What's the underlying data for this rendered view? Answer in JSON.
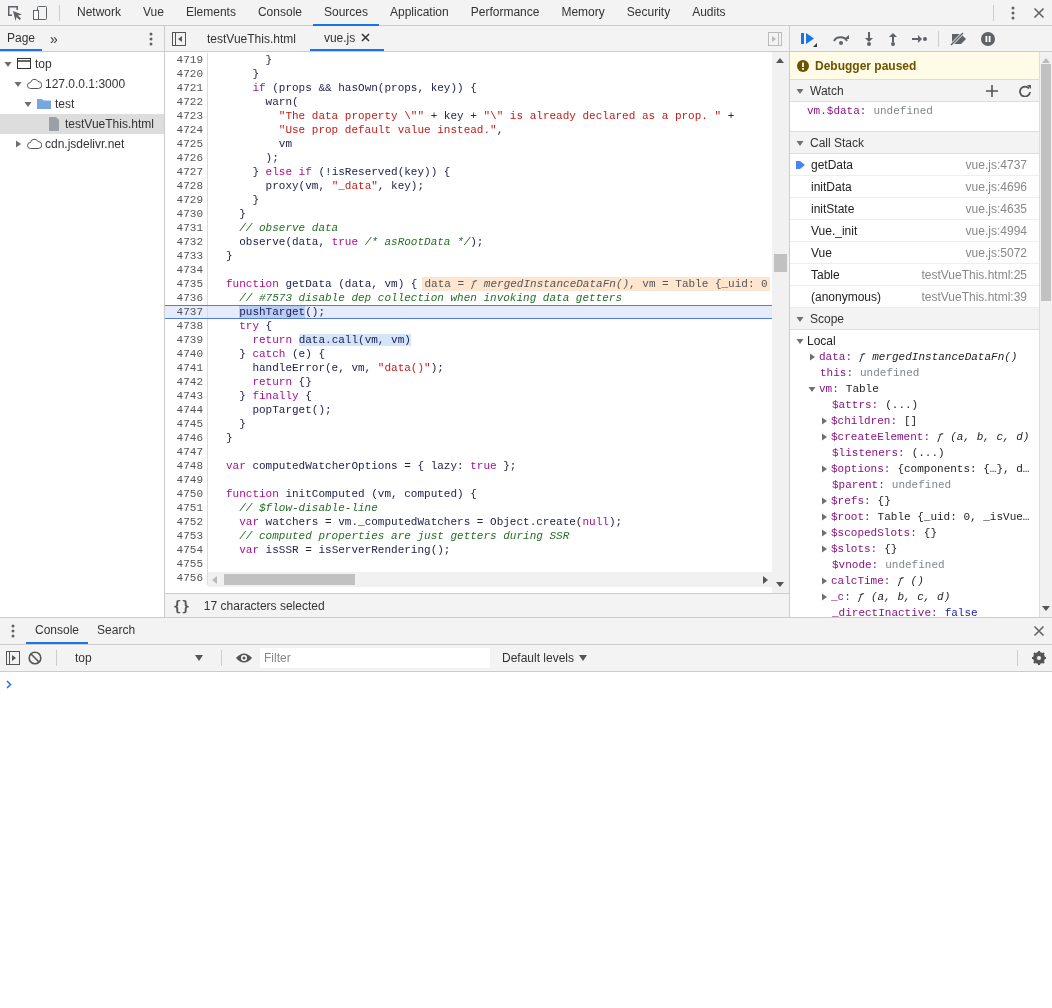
{
  "main_tabs": [
    {
      "label": "Network",
      "selected": false
    },
    {
      "label": "Vue",
      "selected": false
    },
    {
      "label": "Elements",
      "selected": false
    },
    {
      "label": "Console",
      "selected": false
    },
    {
      "label": "Sources",
      "selected": true
    },
    {
      "label": "Application",
      "selected": false
    },
    {
      "label": "Performance",
      "selected": false
    },
    {
      "label": "Memory",
      "selected": false
    },
    {
      "label": "Security",
      "selected": false
    },
    {
      "label": "Audits",
      "selected": false
    }
  ],
  "navigator": {
    "tabs": [
      {
        "label": "Page",
        "selected": true
      }
    ],
    "more_tabs": "»",
    "tree": [
      {
        "label": "top",
        "kind": "frame",
        "expanded": true,
        "selected": false,
        "children": [
          {
            "label": "127.0.0.1:3000",
            "kind": "domain",
            "expanded": true,
            "selected": false,
            "children": [
              {
                "label": "test",
                "kind": "folder",
                "expanded": true,
                "selected": false,
                "children": [
                  {
                    "label": "testVueThis.html",
                    "kind": "file",
                    "selected": true
                  }
                ]
              }
            ]
          },
          {
            "label": "cdn.jsdelivr.net",
            "kind": "domain",
            "expanded": false,
            "selected": false
          }
        ]
      }
    ]
  },
  "editor": {
    "tabs": [
      {
        "label": "testVueThis.html",
        "selected": false,
        "closable": false
      },
      {
        "label": "vue.js",
        "selected": true,
        "closable": true
      }
    ],
    "lines": [
      {
        "n": "4719",
        "current": false,
        "tokens": [
          {
            "t": "      }",
            "kind": "txt"
          }
        ]
      },
      {
        "n": "4720",
        "current": false,
        "tokens": [
          {
            "t": "    }",
            "kind": "txt"
          }
        ]
      },
      {
        "n": "4721",
        "current": false,
        "tokens": [
          {
            "t": "    if",
            "kind": "kw"
          },
          {
            "t": " (props && hasOwn(props, key)) {",
            "kind": "txt"
          }
        ]
      },
      {
        "n": "4722",
        "current": false,
        "tokens": [
          {
            "t": "      warn(",
            "kind": "txt"
          }
        ]
      },
      {
        "n": "4723",
        "current": false,
        "tokens": [
          {
            "t": "        \"The data property \\\"\"",
            "kind": "str"
          },
          {
            "t": " + key + ",
            "kind": "txt"
          },
          {
            "t": "\"\\\" is already declared as a prop. \"",
            "kind": "str"
          },
          {
            "t": " +",
            "kind": "txt"
          }
        ]
      },
      {
        "n": "4724",
        "current": false,
        "tokens": [
          {
            "t": "        \"Use prop default value instead.\"",
            "kind": "str"
          },
          {
            "t": ",",
            "kind": "txt"
          }
        ]
      },
      {
        "n": "4725",
        "current": false,
        "tokens": [
          {
            "t": "        vm",
            "kind": "txt"
          }
        ]
      },
      {
        "n": "4726",
        "current": false,
        "tokens": [
          {
            "t": "      );",
            "kind": "txt"
          }
        ]
      },
      {
        "n": "4727",
        "current": false,
        "tokens": [
          {
            "t": "    } ",
            "kind": "txt"
          },
          {
            "t": "else if",
            "kind": "kw"
          },
          {
            "t": " (!isReserved(key)) {",
            "kind": "txt"
          }
        ]
      },
      {
        "n": "4728",
        "current": false,
        "tokens": [
          {
            "t": "      proxy(vm, ",
            "kind": "txt"
          },
          {
            "t": "\"_data\"",
            "kind": "str"
          },
          {
            "t": ", key);",
            "kind": "txt"
          }
        ]
      },
      {
        "n": "4729",
        "current": false,
        "tokens": [
          {
            "t": "    }",
            "kind": "txt"
          }
        ]
      },
      {
        "n": "4730",
        "current": false,
        "tokens": [
          {
            "t": "  }",
            "kind": "txt"
          }
        ]
      },
      {
        "n": "4731",
        "current": false,
        "tokens": [
          {
            "t": "  // observe data",
            "kind": "cmt"
          }
        ]
      },
      {
        "n": "4732",
        "current": false,
        "tokens": [
          {
            "t": "  observe(data, ",
            "kind": "txt"
          },
          {
            "t": "true",
            "kind": "atom"
          },
          {
            "t": " /* asRootData */",
            "kind": "cmt"
          },
          {
            "t": ");",
            "kind": "txt"
          }
        ]
      },
      {
        "n": "4733",
        "current": false,
        "tokens": [
          {
            "t": "}",
            "kind": "txt"
          }
        ]
      },
      {
        "n": "4734",
        "current": false
      },
      {
        "n": "4735",
        "current": false,
        "tokens": [
          {
            "t": "function",
            "kind": "kw"
          },
          {
            "t": " getData (data, vm) {",
            "kind": "txt"
          }
        ],
        "inline_value": "data = *ƒ mergedInstanceDataFn()*, vm = Table {_uid: 0"
      },
      {
        "n": "4736",
        "current": false,
        "tokens": [
          {
            "t": "  // #7573 disable dep collection when invoking data getters",
            "kind": "cmt"
          }
        ]
      },
      {
        "n": "4737",
        "current": true,
        "tokens": [
          {
            "t": "  pushTarget",
            "kind": "txt",
            "selected": true
          },
          {
            "t": "();",
            "kind": "txt"
          }
        ]
      },
      {
        "n": "4738",
        "current": false,
        "tokens": [
          {
            "t": "  try",
            "kind": "kw"
          },
          {
            "t": " {",
            "kind": "txt"
          }
        ]
      },
      {
        "n": "4739",
        "current": false,
        "tokens": [
          {
            "t": "    return",
            "kind": "kw"
          },
          {
            "t": " data.call(vm, vm)",
            "kind": "txt",
            "evaluated": true
          }
        ]
      },
      {
        "n": "4740",
        "current": false,
        "tokens": [
          {
            "t": "  } ",
            "kind": "txt"
          },
          {
            "t": "catch",
            "kind": "kw"
          },
          {
            "t": " (e) {",
            "kind": "txt"
          }
        ]
      },
      {
        "n": "4741",
        "current": false,
        "tokens": [
          {
            "t": "    handleError(e, vm, ",
            "kind": "txt"
          },
          {
            "t": "\"data()\"",
            "kind": "str"
          },
          {
            "t": ");",
            "kind": "txt"
          }
        ]
      },
      {
        "n": "4742",
        "current": false,
        "tokens": [
          {
            "t": "    return",
            "kind": "kw"
          },
          {
            "t": " {}",
            "kind": "txt"
          }
        ]
      },
      {
        "n": "4743",
        "current": false,
        "tokens": [
          {
            "t": "  } ",
            "kind": "txt"
          },
          {
            "t": "finally",
            "kind": "kw"
          },
          {
            "t": " {",
            "kind": "txt"
          }
        ]
      },
      {
        "n": "4744",
        "current": false,
        "tokens": [
          {
            "t": "    popTarget();",
            "kind": "txt"
          }
        ]
      },
      {
        "n": "4745",
        "current": false,
        "tokens": [
          {
            "t": "  }",
            "kind": "txt"
          }
        ]
      },
      {
        "n": "4746",
        "current": false,
        "tokens": [
          {
            "t": "}",
            "kind": "txt"
          }
        ]
      },
      {
        "n": "4747",
        "current": false
      },
      {
        "n": "4748",
        "current": false,
        "tokens": [
          {
            "t": "var",
            "kind": "kw"
          },
          {
            "t": " computedWatcherOptions = { lazy: ",
            "kind": "txt"
          },
          {
            "t": "true",
            "kind": "atom"
          },
          {
            "t": " };",
            "kind": "txt"
          }
        ]
      },
      {
        "n": "4749",
        "current": false
      },
      {
        "n": "4750",
        "current": false,
        "tokens": [
          {
            "t": "function",
            "kind": "kw"
          },
          {
            "t": " initComputed (vm, computed) {",
            "kind": "txt"
          }
        ]
      },
      {
        "n": "4751",
        "current": false,
        "tokens": [
          {
            "t": "  // $flow-disable-line",
            "kind": "cmt"
          }
        ]
      },
      {
        "n": "4752",
        "current": false,
        "tokens": [
          {
            "t": "  var",
            "kind": "kw"
          },
          {
            "t": " watchers = vm._computedWatchers = Object.create(",
            "kind": "txt"
          },
          {
            "t": "null",
            "kind": "atom"
          },
          {
            "t": ");",
            "kind": "txt"
          }
        ]
      },
      {
        "n": "4753",
        "current": false,
        "tokens": [
          {
            "t": "  // computed properties are just getters during SSR",
            "kind": "cmt"
          }
        ]
      },
      {
        "n": "4754",
        "current": false,
        "tokens": [
          {
            "t": "  var",
            "kind": "kw"
          },
          {
            "t": " isSSR = isServerRendering();",
            "kind": "txt"
          }
        ]
      },
      {
        "n": "4755",
        "current": false
      },
      {
        "n": "4756",
        "current": false
      }
    ],
    "pretty_print": "{}",
    "status": "17 characters selected"
  },
  "debugger": {
    "banner": "Debugger paused",
    "watch": {
      "title": "Watch",
      "expanded": true,
      "items": [
        {
          "expression": "vm.$data:",
          "value": "undefined"
        }
      ]
    },
    "call_stack": {
      "title": "Call Stack",
      "expanded": true,
      "frames": [
        {
          "name": "getData",
          "location": "vue.js:4737",
          "selected": true
        },
        {
          "name": "initData",
          "location": "vue.js:4696",
          "selected": false
        },
        {
          "name": "initState",
          "location": "vue.js:4635",
          "selected": false
        },
        {
          "name": "Vue._init",
          "location": "vue.js:4994",
          "selected": false
        },
        {
          "name": "Vue",
          "location": "vue.js:5072",
          "selected": false
        },
        {
          "name": "Table",
          "location": "testVueThis.html:25",
          "selected": false
        },
        {
          "name": "(anonymous)",
          "location": "testVueThis.html:39",
          "selected": false
        }
      ]
    },
    "scope": {
      "title": "Scope",
      "expanded": true,
      "tree": [
        {
          "name": "Local",
          "expanded": true,
          "children": [
            {
              "name": "data:",
              "value": "ƒ mergedInstanceDataFn()",
              "kind": "function",
              "expanded": false
            },
            {
              "name": "this:",
              "value": "undefined",
              "kind": "undefined"
            },
            {
              "name": "vm:",
              "value": "Table",
              "kind": "object",
              "expanded": true,
              "children": [
                {
                  "name": "$attrs:",
                  "value": "(...)",
                  "kind": "object"
                },
                {
                  "name": "$children:",
                  "value": "[]",
                  "kind": "object",
                  "expanded": false
                },
                {
                  "name": "$createElement:",
                  "value": "ƒ (a, b, c, d)",
                  "kind": "function",
                  "expanded": false
                },
                {
                  "name": "$listeners:",
                  "value": "(...)",
                  "kind": "object"
                },
                {
                  "name": "$options:",
                  "value": "{components: {…}, d…",
                  "kind": "object",
                  "expanded": false
                },
                {
                  "name": "$parent:",
                  "value": "undefined",
                  "kind": "undefined"
                },
                {
                  "name": "$refs:",
                  "value": "{}",
                  "kind": "object",
                  "expanded": false
                },
                {
                  "name": "$root:",
                  "value": "Table {_uid: 0, _isVue…",
                  "kind": "object",
                  "expanded": false
                },
                {
                  "name": "$scopedSlots:",
                  "value": "{}",
                  "kind": "object",
                  "expanded": false
                },
                {
                  "name": "$slots:",
                  "value": "{}",
                  "kind": "object",
                  "expanded": false
                },
                {
                  "name": "$vnode:",
                  "value": "undefined",
                  "kind": "undefined"
                },
                {
                  "name": "calcTime:",
                  "value": "ƒ ()",
                  "kind": "function",
                  "expanded": false
                },
                {
                  "name": "_c:",
                  "value": "ƒ (a, b, c, d)",
                  "kind": "function",
                  "expanded": false
                },
                {
                  "name": "_directInactive:",
                  "value": "false",
                  "kind": "boolean"
                }
              ]
            }
          ]
        }
      ]
    }
  },
  "drawer": {
    "tabs": [
      {
        "label": "Console",
        "selected": true
      },
      {
        "label": "Search",
        "selected": false
      }
    ],
    "context": "top",
    "filter": {
      "placeholder": "Filter"
    },
    "levels": "Default levels"
  }
}
